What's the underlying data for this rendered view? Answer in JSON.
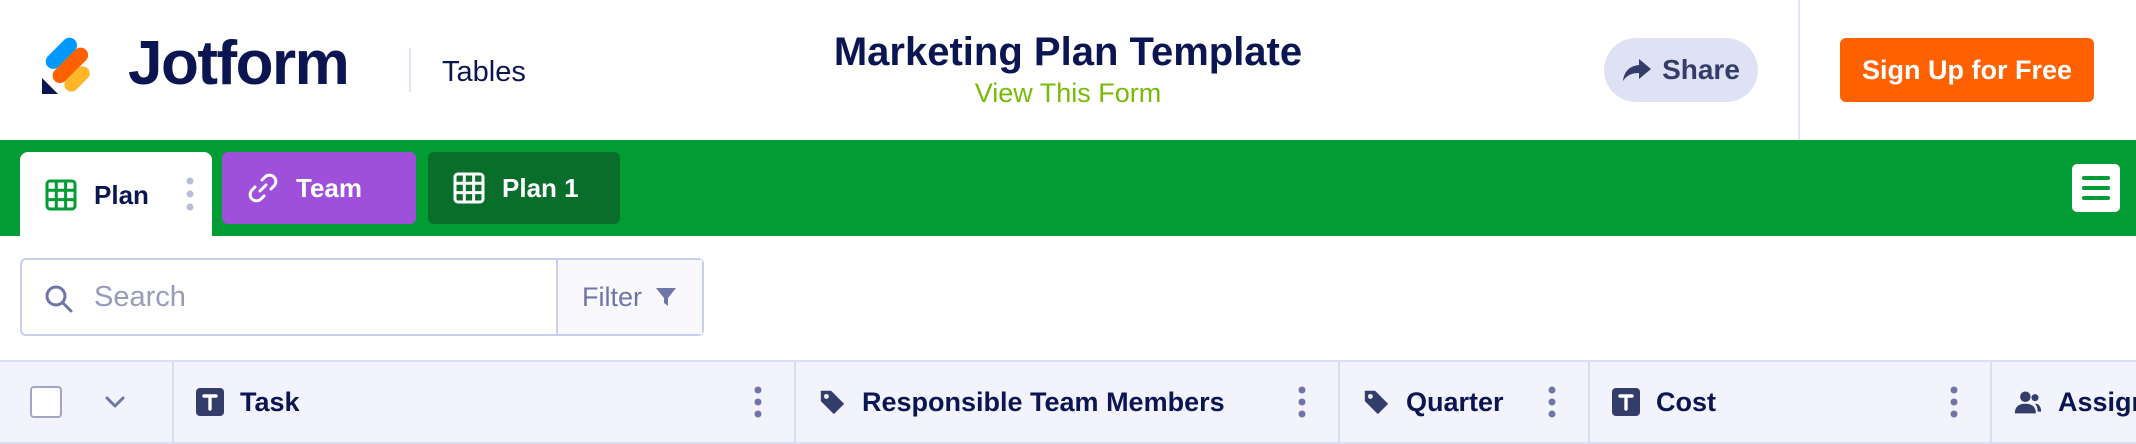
{
  "header": {
    "brand": "Jotform",
    "app_name": "Tables",
    "form_title": "Marketing Plan Template",
    "form_link": "View This Form",
    "share_label": "Share",
    "signup_label": "Sign Up for Free",
    "logo_icon": "jotform-logo-icon",
    "share_icon": "share-arrow-icon"
  },
  "tabs": [
    {
      "label": "Plan",
      "icon": "grid-icon",
      "active": true,
      "color": "#ffffff"
    },
    {
      "label": "Team",
      "icon": "link-icon",
      "active": false,
      "color": "#9e50da"
    },
    {
      "label": "Plan 1",
      "icon": "grid-icon",
      "active": false,
      "color": "#0a6e2b"
    }
  ],
  "toolbar": {
    "search_placeholder": "Search",
    "filter_label": "Filter"
  },
  "table": {
    "columns": [
      {
        "label": "Task",
        "icon": "text-type-icon"
      },
      {
        "label": "Responsible Team Members",
        "icon": "tag-icon"
      },
      {
        "label": "Quarter",
        "icon": "tag-icon"
      },
      {
        "label": "Cost",
        "icon": "text-type-icon"
      },
      {
        "label": "Assign",
        "icon": "users-icon"
      }
    ]
  },
  "colors": {
    "tabbar": "#029c34",
    "signup": "#ff6100",
    "link": "#78bb07",
    "text": "#0a1551"
  }
}
